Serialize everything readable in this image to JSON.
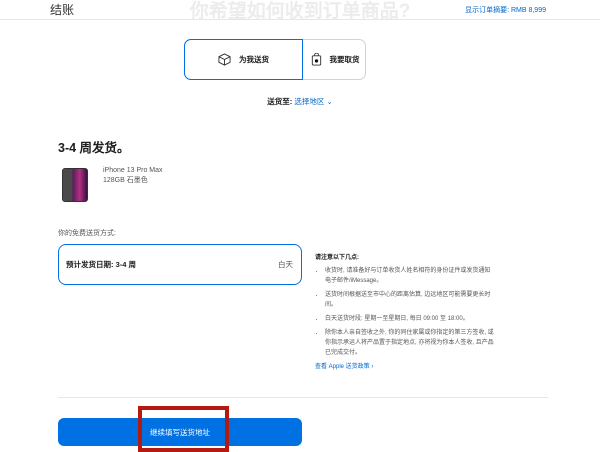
{
  "header": {
    "title": "结账",
    "heading": "你希望如何收到订单商品?",
    "summary": "显示订单摘要: RMB 8,999"
  },
  "delivery_options": [
    {
      "label": "为我送货",
      "icon": "box-icon",
      "selected": true
    },
    {
      "label": "我要取货",
      "icon": "bag-icon",
      "selected": false
    }
  ],
  "ship_to": {
    "label": "送货至:",
    "value": "选择地区"
  },
  "shipping": {
    "heading": "3-4 周发货。",
    "product_name": "iPhone 13 Pro Max",
    "product_variant": "128GB 石墨色",
    "free_label": "你的免费送货方式:",
    "option_date": "预计发货日期: 3-4 周",
    "option_time": "白天"
  },
  "notes": {
    "heading": "请注意以下几点:",
    "items": [
      "收货时, 请准备好与订单收货人姓名相符的身份证件或发货通知电子邮件/iMessage。",
      "送货时间根据送至市中心的距离估算, 边远地区可能需要更长时间。",
      "白天送货时段: 星期一至星期日, 每日 09:00 至 18:00。",
      "除你本人亲自签收之外, 你的同住家属或你指定的第三方签收, 或你指示承运人将产品置于指定地点, 亦将视为你本人签收, 且产品已完成交付。"
    ],
    "link": "查看 Apple 送货政策 ›"
  },
  "continue_button": "继续填写送货地址",
  "colors": {
    "accent": "#0071e3",
    "annotation": "#b51a12"
  }
}
